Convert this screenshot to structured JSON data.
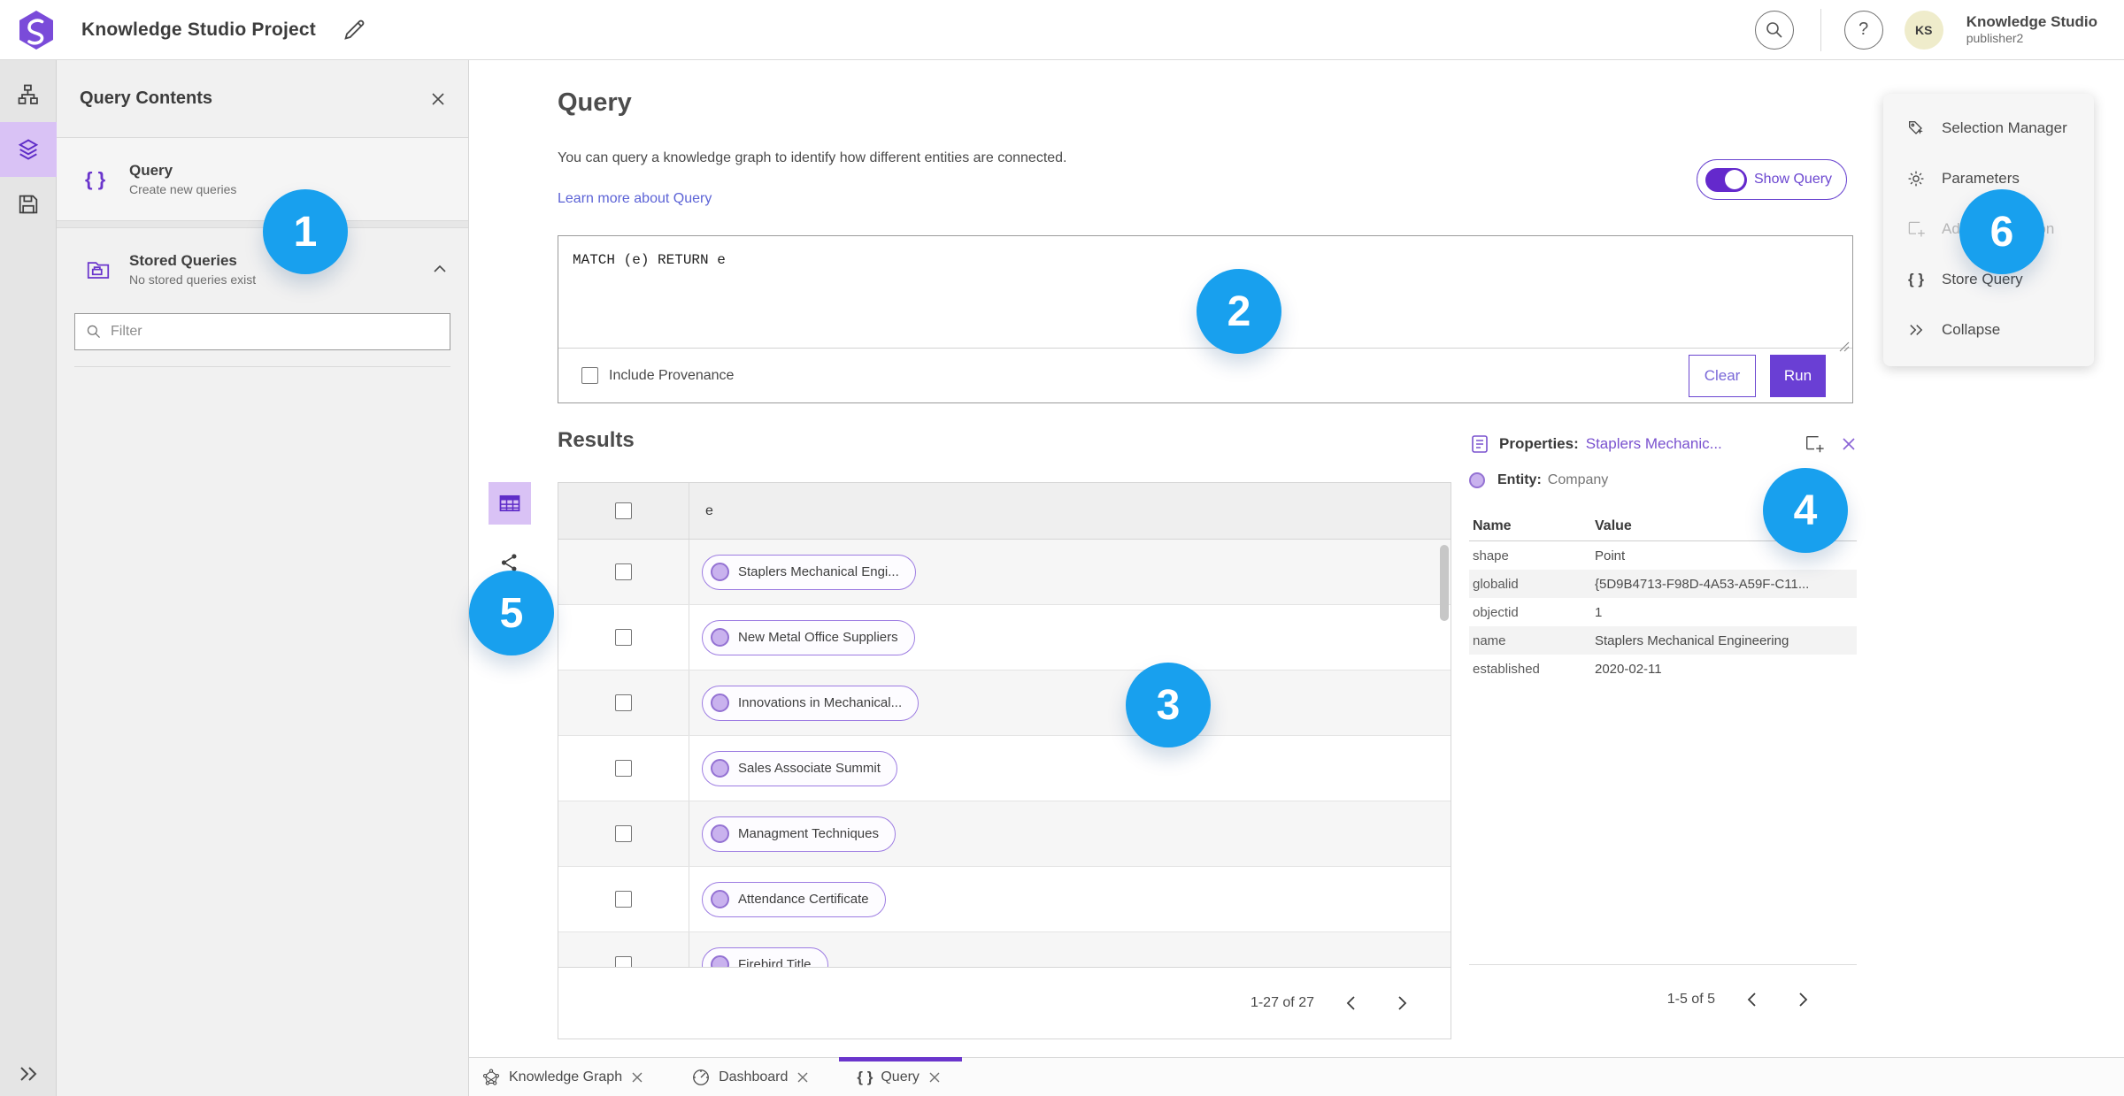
{
  "topbar": {
    "title": "Knowledge Studio Project",
    "user_name": "Knowledge Studio",
    "user_role": "publisher2",
    "avatar_initials": "KS"
  },
  "icons": {
    "help_glyph": "?",
    "braces_glyph": "{ }"
  },
  "query_contents": {
    "title": "Query Contents",
    "query_item": {
      "title": "Query",
      "subtitle": "Create new queries"
    },
    "stored_item": {
      "title": "Stored Queries",
      "subtitle": "No stored queries exist"
    },
    "filter_placeholder": "Filter"
  },
  "query_panel": {
    "heading": "Query",
    "description": "You can query a knowledge graph to identify how different entities are connected.",
    "learn_more_label": "Learn more about Query",
    "show_query_label": "Show Query",
    "query_text": "MATCH (e) RETURN e",
    "include_provenance_label": "Include Provenance",
    "clear_label": "Clear",
    "run_label": "Run"
  },
  "results": {
    "heading": "Results",
    "column_header": "e",
    "rows": [
      "Staplers Mechanical Engi...",
      "New Metal Office Suppliers",
      "Innovations in Mechanical...",
      "Sales Associate Summit",
      "Managment Techniques",
      "Attendance Certificate",
      "Firebird Title"
    ],
    "pagination": "1-27 of 27"
  },
  "properties_panel": {
    "heading": "Properties:",
    "selected_entity": "Staplers Mechanic...",
    "entity_label": "Entity:",
    "entity_type": "Company",
    "name_header": "Name",
    "value_header": "Value",
    "rows": [
      {
        "name": "shape",
        "value": "Point"
      },
      {
        "name": "globalid",
        "value": "{5D9B4713-F98D-4A53-A59F-C11..."
      },
      {
        "name": "objectid",
        "value": "1"
      },
      {
        "name": "name",
        "value": "Staplers Mechanical Engineering"
      },
      {
        "name": "established",
        "value": "2020-02-11"
      }
    ],
    "pagination": "1-5 of 5"
  },
  "right_menu": {
    "items": [
      "Selection Manager",
      "Parameters",
      "Add To Selection",
      "Store Query",
      "Collapse"
    ]
  },
  "bottom_tabs": [
    "Knowledge Graph",
    "Dashboard",
    "Query"
  ],
  "badges": [
    "1",
    "2",
    "3",
    "4",
    "5",
    "6"
  ],
  "colors": {
    "accent_purple": "#6a3fd4",
    "selected_lavender": "#d9c2f5",
    "badge_blue": "#18a0ee",
    "link_blue": "#5c63d6",
    "entity_border_purple": "#9d7ce2"
  }
}
